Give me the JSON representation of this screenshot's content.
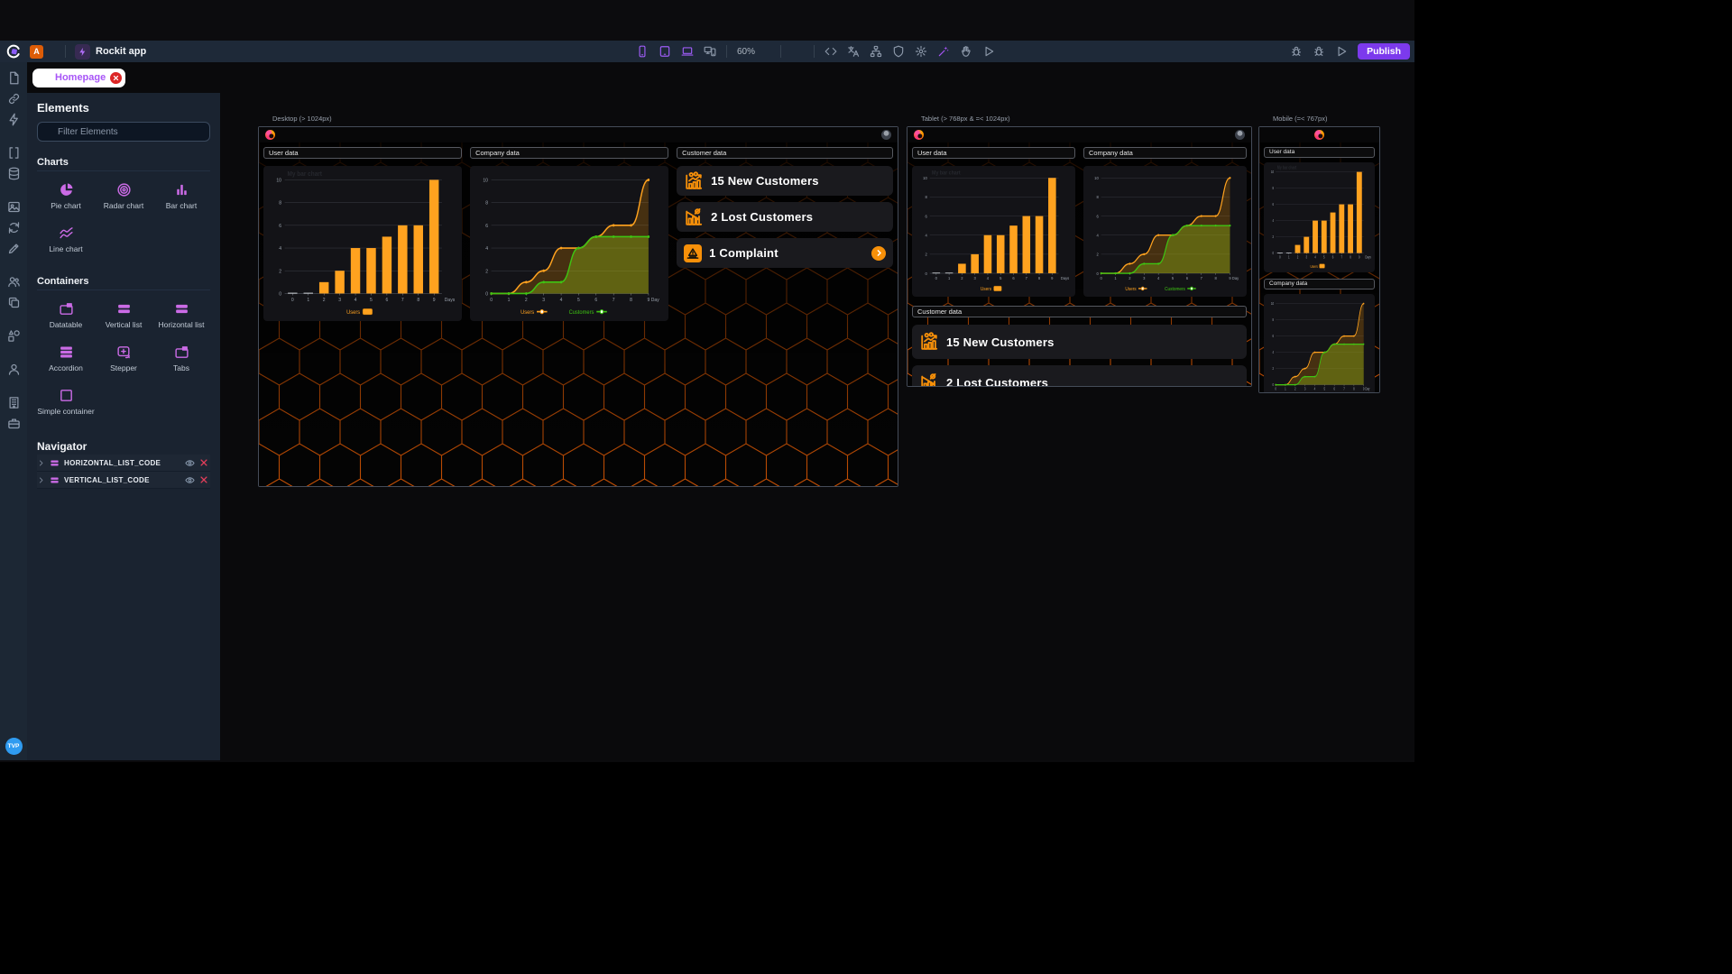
{
  "header": {
    "workspace_badge": "A",
    "app_name": "Rockit app",
    "zoom_level": "60%",
    "publish_label": "Publish"
  },
  "toolbar": {
    "device_icons": [
      "phone",
      "tablet",
      "laptop",
      "devices"
    ],
    "tool_icons": [
      "code",
      "translate",
      "sitemap",
      "shield",
      "gear",
      "wand",
      "hand",
      "play"
    ],
    "right_icons": [
      "bug",
      "bug",
      "play"
    ]
  },
  "rail": {
    "groups": [
      [
        "file",
        "link",
        "bolt"
      ],
      [
        "brackets",
        "database"
      ],
      [
        "image",
        "sync",
        "pen"
      ],
      [
        "users",
        "copy"
      ],
      [
        "shapes"
      ],
      [
        "person"
      ],
      [
        "building",
        "briefcase"
      ]
    ]
  },
  "tab": {
    "label": "Homepage"
  },
  "elements_panel": {
    "title": "Elements",
    "search_placeholder": "Filter Elements",
    "sections": [
      {
        "title": "Charts",
        "items": [
          {
            "icon": "pie-chart",
            "label": "Pie chart"
          },
          {
            "icon": "radar-chart",
            "label": "Radar chart"
          },
          {
            "icon": "bar-chart",
            "label": "Bar chart"
          },
          {
            "icon": "line-chart",
            "label": "Line chart"
          }
        ]
      },
      {
        "title": "Containers",
        "items": [
          {
            "icon": "datatable",
            "label": "Datatable"
          },
          {
            "icon": "vertical-list",
            "label": "Vertical list"
          },
          {
            "icon": "horizontal-list",
            "label": "Horizontal list"
          },
          {
            "icon": "accordion",
            "label": "Accordion"
          },
          {
            "icon": "stepper",
            "label": "Stepper"
          },
          {
            "icon": "tabs",
            "label": "Tabs"
          },
          {
            "icon": "simple-container",
            "label": "Simple container"
          }
        ]
      }
    ]
  },
  "navigator": {
    "title": "Navigator",
    "items": [
      {
        "label": "HORIZONTAL_LIST_CODE"
      },
      {
        "label": "VERTICAL_LIST_CODE"
      }
    ]
  },
  "previews": [
    {
      "label": "Desktop (> 1024px)"
    },
    {
      "label": "Tablet (> 768px & =< 1024px)"
    },
    {
      "label": "Mobile (=< 767px)"
    }
  ],
  "dashboard": {
    "section_user": "User data",
    "section_company": "Company data",
    "section_customer": "Customer data",
    "kpis": [
      {
        "icon": "kpi-new",
        "label": "15 New Customers",
        "has_arrow": false
      },
      {
        "icon": "kpi-lost",
        "label": "2 Lost Customers",
        "has_arrow": false
      },
      {
        "icon": "kpi-complaint",
        "label": "1 Complaint",
        "has_arrow": true
      }
    ]
  },
  "user_menu": {
    "avatar_initials": "TVP"
  },
  "colors": {
    "accent_purple": "#7c3aed",
    "element_magenta": "#cb6be6",
    "chart_orange": "#ffa21f",
    "chart_green": "#3ec412",
    "hex_pattern_orange": "#e85d04",
    "close_red": "#dc2626",
    "kpi_orange": "#f79009"
  },
  "chart_data": [
    {
      "id": "user-bar-chart",
      "type": "bar",
      "title": "My bar chart",
      "categories": [
        "0",
        "1",
        "2",
        "3",
        "4",
        "5",
        "6",
        "7",
        "8",
        "9"
      ],
      "series": [
        {
          "name": "Users",
          "values": [
            0,
            0,
            1,
            2,
            4,
            4,
            5,
            6,
            6,
            10
          ],
          "color": "#ffa21f"
        }
      ],
      "xlabel": "Days",
      "ylabel": "",
      "ylim": [
        0,
        10
      ],
      "yticks": [
        0,
        2,
        4,
        6,
        8,
        10
      ],
      "grid": true,
      "legend_position": "bottom"
    },
    {
      "id": "company-line-chart",
      "type": "area",
      "x": [
        0,
        1,
        2,
        3,
        4,
        5,
        6,
        7,
        8,
        9
      ],
      "series": [
        {
          "name": "Users",
          "values": [
            0,
            0,
            1,
            2,
            4,
            4,
            5,
            6,
            6,
            10
          ],
          "color": "#ffa21f"
        },
        {
          "name": "Customers",
          "values": [
            0,
            0,
            0,
            1,
            1,
            4,
            5,
            5,
            5,
            5
          ],
          "color": "#3ec412"
        }
      ],
      "xlabel": "Day",
      "ylabel": "",
      "ylim": [
        0,
        10
      ],
      "yticks": [
        0,
        2,
        4,
        6,
        8,
        10
      ],
      "grid": true,
      "legend_position": "bottom"
    }
  ]
}
